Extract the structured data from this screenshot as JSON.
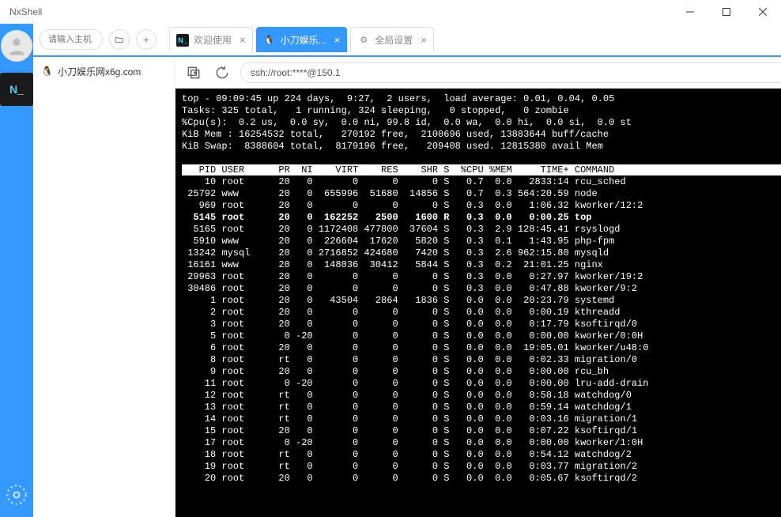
{
  "window": {
    "title": "NxShell"
  },
  "tabbar": {
    "host_placeholder": "请输入主机",
    "tabs": [
      {
        "label": "欢迎使用"
      },
      {
        "label": "小刀娱乐..."
      },
      {
        "label": "全局设置"
      }
    ]
  },
  "tree": {
    "item0": "小刀娱乐网x6g.com"
  },
  "address": {
    "value": "ssh://root:****@150.1"
  },
  "top": {
    "summary": [
      "top - 09:09:45 up 224 days,  9:27,  2 users,  load average: 0.01, 0.04, 0.05",
      "Tasks: 325 total,   1 running, 324 sleeping,   0 stopped,   0 zombie",
      "%Cpu(s):  0.2 us,  0.0 sy,  0.0 ni, 99.8 id,  0.0 wa,  0.0 hi,  0.0 si,  0.0 st",
      "KiB Mem : 16254532 total,   270192 free,  2100696 used, 13883644 buff/cache",
      "KiB Swap:  8388604 total,  8179196 free,   209408 used. 12815380 avail Mem"
    ],
    "columns": [
      "PID",
      "USER",
      "PR",
      "NI",
      "VIRT",
      "RES",
      "SHR",
      "S",
      "%CPU",
      "%MEM",
      "TIME+",
      "COMMAND"
    ],
    "rows": [
      {
        "pid": "10",
        "user": "root",
        "pr": "20",
        "ni": "0",
        "virt": "0",
        "res": "0",
        "shr": "0",
        "s": "S",
        "cpu": "0.7",
        "mem": "0.0",
        "time": "2833:14",
        "cmd": "rcu_sched"
      },
      {
        "pid": "25792",
        "user": "www",
        "pr": "20",
        "ni": "0",
        "virt": "655996",
        "res": "51680",
        "shr": "14856",
        "s": "S",
        "cpu": "0.7",
        "mem": "0.3",
        "time": "564:20.59",
        "cmd": "node"
      },
      {
        "pid": "969",
        "user": "root",
        "pr": "20",
        "ni": "0",
        "virt": "0",
        "res": "0",
        "shr": "0",
        "s": "S",
        "cpu": "0.3",
        "mem": "0.0",
        "time": "1:06.32",
        "cmd": "kworker/12:2"
      },
      {
        "pid": "5145",
        "user": "root",
        "pr": "20",
        "ni": "0",
        "virt": "162252",
        "res": "2500",
        "shr": "1600",
        "s": "R",
        "cpu": "0.3",
        "mem": "0.0",
        "time": "0:00.25",
        "cmd": "top",
        "bold": true
      },
      {
        "pid": "5165",
        "user": "root",
        "pr": "20",
        "ni": "0",
        "virt": "1172408",
        "res": "477800",
        "shr": "37604",
        "s": "S",
        "cpu": "0.3",
        "mem": "2.9",
        "time": "128:45.41",
        "cmd": "rsyslogd"
      },
      {
        "pid": "5910",
        "user": "www",
        "pr": "20",
        "ni": "0",
        "virt": "226604",
        "res": "17620",
        "shr": "5820",
        "s": "S",
        "cpu": "0.3",
        "mem": "0.1",
        "time": "1:43.95",
        "cmd": "php-fpm"
      },
      {
        "pid": "13242",
        "user": "mysql",
        "pr": "20",
        "ni": "0",
        "virt": "2716852",
        "res": "424680",
        "shr": "7420",
        "s": "S",
        "cpu": "0.3",
        "mem": "2.6",
        "time": "962:15.80",
        "cmd": "mysqld"
      },
      {
        "pid": "16161",
        "user": "www",
        "pr": "20",
        "ni": "0",
        "virt": "148036",
        "res": "30412",
        "shr": "5844",
        "s": "S",
        "cpu": "0.3",
        "mem": "0.2",
        "time": "21:01.25",
        "cmd": "nginx"
      },
      {
        "pid": "29963",
        "user": "root",
        "pr": "20",
        "ni": "0",
        "virt": "0",
        "res": "0",
        "shr": "0",
        "s": "S",
        "cpu": "0.3",
        "mem": "0.0",
        "time": "0:27.97",
        "cmd": "kworker/19:2"
      },
      {
        "pid": "30486",
        "user": "root",
        "pr": "20",
        "ni": "0",
        "virt": "0",
        "res": "0",
        "shr": "0",
        "s": "S",
        "cpu": "0.3",
        "mem": "0.0",
        "time": "0:47.88",
        "cmd": "kworker/9:2"
      },
      {
        "pid": "1",
        "user": "root",
        "pr": "20",
        "ni": "0",
        "virt": "43504",
        "res": "2864",
        "shr": "1836",
        "s": "S",
        "cpu": "0.0",
        "mem": "0.0",
        "time": "20:23.79",
        "cmd": "systemd"
      },
      {
        "pid": "2",
        "user": "root",
        "pr": "20",
        "ni": "0",
        "virt": "0",
        "res": "0",
        "shr": "0",
        "s": "S",
        "cpu": "0.0",
        "mem": "0.0",
        "time": "0:00.19",
        "cmd": "kthreadd"
      },
      {
        "pid": "3",
        "user": "root",
        "pr": "20",
        "ni": "0",
        "virt": "0",
        "res": "0",
        "shr": "0",
        "s": "S",
        "cpu": "0.0",
        "mem": "0.0",
        "time": "0:17.79",
        "cmd": "ksoftirqd/0"
      },
      {
        "pid": "5",
        "user": "root",
        "pr": "0",
        "ni": "-20",
        "virt": "0",
        "res": "0",
        "shr": "0",
        "s": "S",
        "cpu": "0.0",
        "mem": "0.0",
        "time": "0:00.00",
        "cmd": "kworker/0:0H"
      },
      {
        "pid": "6",
        "user": "root",
        "pr": "20",
        "ni": "0",
        "virt": "0",
        "res": "0",
        "shr": "0",
        "s": "S",
        "cpu": "0.0",
        "mem": "0.0",
        "time": "19:05.01",
        "cmd": "kworker/u48:0"
      },
      {
        "pid": "8",
        "user": "root",
        "pr": "rt",
        "ni": "0",
        "virt": "0",
        "res": "0",
        "shr": "0",
        "s": "S",
        "cpu": "0.0",
        "mem": "0.0",
        "time": "0:02.33",
        "cmd": "migration/0"
      },
      {
        "pid": "9",
        "user": "root",
        "pr": "20",
        "ni": "0",
        "virt": "0",
        "res": "0",
        "shr": "0",
        "s": "S",
        "cpu": "0.0",
        "mem": "0.0",
        "time": "0:00.00",
        "cmd": "rcu_bh"
      },
      {
        "pid": "11",
        "user": "root",
        "pr": "0",
        "ni": "-20",
        "virt": "0",
        "res": "0",
        "shr": "0",
        "s": "S",
        "cpu": "0.0",
        "mem": "0.0",
        "time": "0:00.00",
        "cmd": "lru-add-drain"
      },
      {
        "pid": "12",
        "user": "root",
        "pr": "rt",
        "ni": "0",
        "virt": "0",
        "res": "0",
        "shr": "0",
        "s": "S",
        "cpu": "0.0",
        "mem": "0.0",
        "time": "0:58.18",
        "cmd": "watchdog/0"
      },
      {
        "pid": "13",
        "user": "root",
        "pr": "rt",
        "ni": "0",
        "virt": "0",
        "res": "0",
        "shr": "0",
        "s": "S",
        "cpu": "0.0",
        "mem": "0.0",
        "time": "0:59.14",
        "cmd": "watchdog/1"
      },
      {
        "pid": "14",
        "user": "root",
        "pr": "rt",
        "ni": "0",
        "virt": "0",
        "res": "0",
        "shr": "0",
        "s": "S",
        "cpu": "0.0",
        "mem": "0.0",
        "time": "0:03.16",
        "cmd": "migration/1"
      },
      {
        "pid": "15",
        "user": "root",
        "pr": "20",
        "ni": "0",
        "virt": "0",
        "res": "0",
        "shr": "0",
        "s": "S",
        "cpu": "0.0",
        "mem": "0.0",
        "time": "0:07.22",
        "cmd": "ksoftirqd/1"
      },
      {
        "pid": "17",
        "user": "root",
        "pr": "0",
        "ni": "-20",
        "virt": "0",
        "res": "0",
        "shr": "0",
        "s": "S",
        "cpu": "0.0",
        "mem": "0.0",
        "time": "0:00.00",
        "cmd": "kworker/1:0H"
      },
      {
        "pid": "18",
        "user": "root",
        "pr": "rt",
        "ni": "0",
        "virt": "0",
        "res": "0",
        "shr": "0",
        "s": "S",
        "cpu": "0.0",
        "mem": "0.0",
        "time": "0:54.12",
        "cmd": "watchdog/2"
      },
      {
        "pid": "19",
        "user": "root",
        "pr": "rt",
        "ni": "0",
        "virt": "0",
        "res": "0",
        "shr": "0",
        "s": "S",
        "cpu": "0.0",
        "mem": "0.0",
        "time": "0:03.77",
        "cmd": "migration/2"
      },
      {
        "pid": "20",
        "user": "root",
        "pr": "20",
        "ni": "0",
        "virt": "0",
        "res": "0",
        "shr": "0",
        "s": "S",
        "cpu": "0.0",
        "mem": "0.0",
        "time": "0:05.67",
        "cmd": "ksoftirqd/2"
      }
    ]
  }
}
